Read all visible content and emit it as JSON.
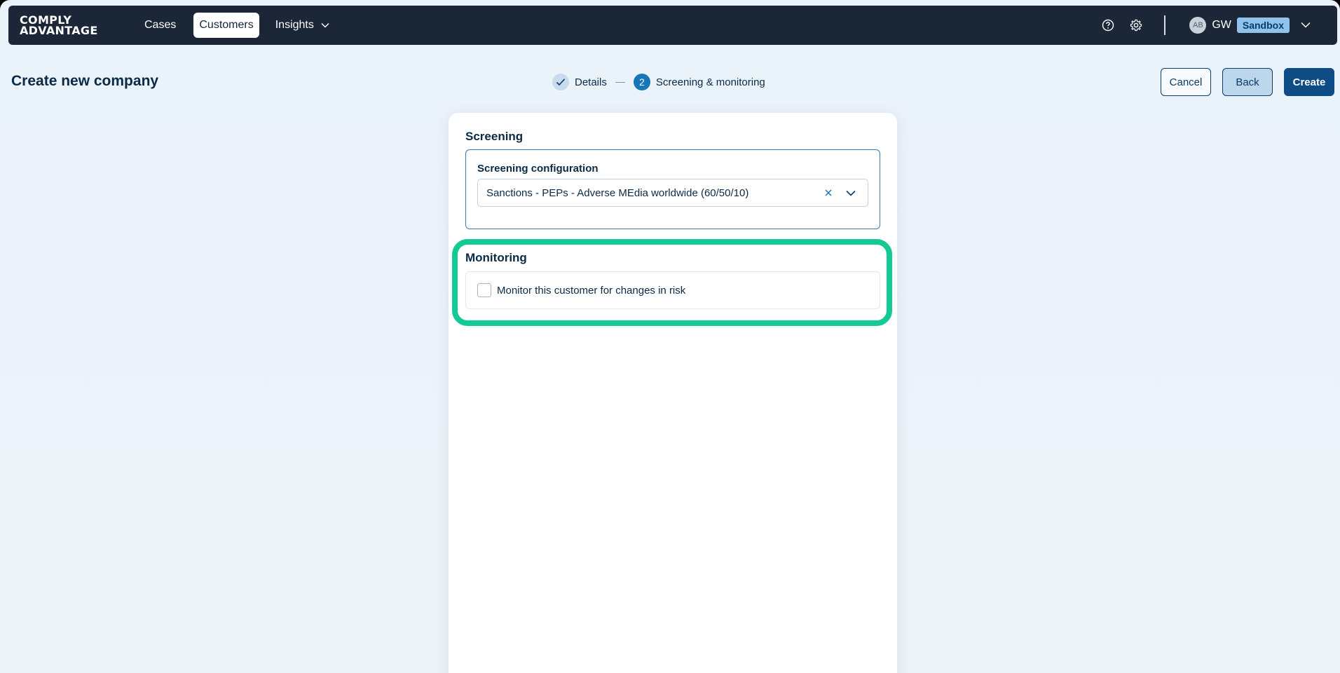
{
  "nav": {
    "logo_line1": "COMPLY",
    "logo_line2": "ADVANTAGE",
    "items": [
      {
        "label": "Cases"
      },
      {
        "label": "Customers"
      },
      {
        "label": "Insights"
      }
    ],
    "active_item": "Customers",
    "account": {
      "avatar_initials": "AB",
      "name": "GW",
      "environment_badge": "Sandbox"
    },
    "icons": [
      "help-icon",
      "gear-icon",
      "chevron-down-icon"
    ]
  },
  "header": {
    "title": "Create new company",
    "steps": [
      {
        "label": "Details",
        "state": "complete"
      },
      {
        "number": "2",
        "label": "Screening & monitoring",
        "state": "current"
      }
    ],
    "buttons": {
      "cancel": "Cancel",
      "back": "Back",
      "create": "Create"
    }
  },
  "screening": {
    "title": "Screening",
    "config_label": "Screening configuration",
    "config_value": "Sanctions - PEPs - Adverse MEdia worldwide (60/50/10)"
  },
  "monitoring": {
    "title": "Monitoring",
    "checkbox_label": "Monitor this customer for changes in risk",
    "checked": false
  },
  "colors": {
    "nav_bg": "#1b2736",
    "primary": "#0e4c86",
    "step_active": "#1677b8",
    "highlight": "#13c994",
    "sandbox_badge": "#8fc3ee"
  }
}
